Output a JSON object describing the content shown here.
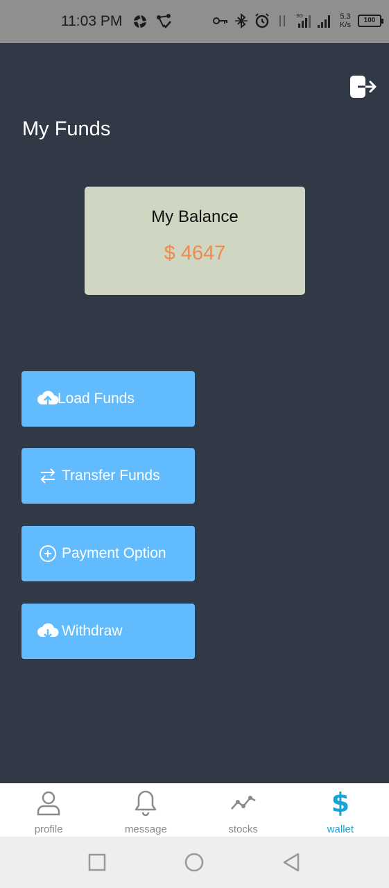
{
  "status_bar": {
    "time": "11:03 PM",
    "network_type": "3G",
    "net_speed_value": "5.3",
    "net_speed_unit": "K/s",
    "battery_level": "100"
  },
  "header": {
    "title": "My Funds",
    "logout_icon": "logout-icon"
  },
  "balance_card": {
    "label": "My Balance",
    "amount": "$ 4647",
    "amount_color": "#f08a4f",
    "background": "#cfd6c1"
  },
  "actions": [
    {
      "label": "Load Funds",
      "icon": "cloud-upload-icon"
    },
    {
      "label": "Transfer Funds",
      "icon": "swap-arrows-icon"
    },
    {
      "label": "Payment Option",
      "icon": "plus-circle-icon"
    },
    {
      "label": "Withdraw",
      "icon": "cloud-download-icon"
    }
  ],
  "bottom_nav": {
    "items": [
      {
        "label": "profile",
        "icon": "person-icon"
      },
      {
        "label": "message",
        "icon": "bell-icon"
      },
      {
        "label": "stocks",
        "icon": "trend-line-icon"
      },
      {
        "label": "wallet",
        "icon": "dollar-icon",
        "active": true,
        "glyph": "$"
      }
    ],
    "active_color": "#17a4d8"
  },
  "system_nav": {
    "recent": "square-icon",
    "home": "circle-icon",
    "back": "triangle-back-icon"
  },
  "colors": {
    "background": "#313846",
    "button": "#62bbfd",
    "status_bar": "#8f8f8f"
  }
}
